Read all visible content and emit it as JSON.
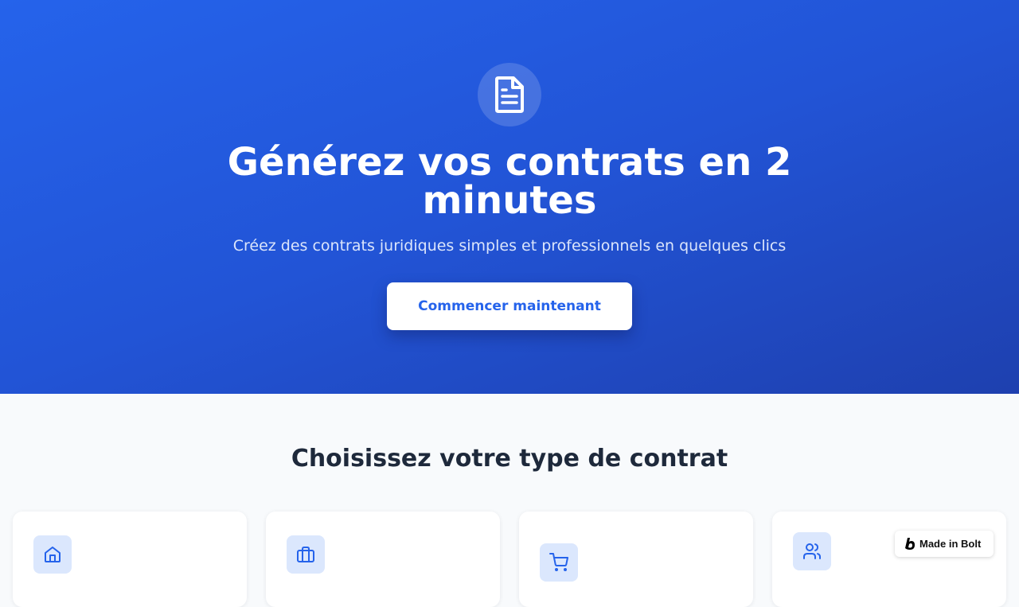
{
  "hero": {
    "icon": "document-text-icon",
    "title": "Générez vos contrats en 2 minutes",
    "subtitle": "Créez des contrats juridiques simples et professionnels en quelques clics",
    "cta_label": "Commencer maintenant"
  },
  "contract_section": {
    "title": "Choisissez votre type de contrat",
    "cards": [
      {
        "icon": "home-icon"
      },
      {
        "icon": "briefcase-icon"
      },
      {
        "icon": "shopping-cart-icon"
      },
      {
        "icon": "users-icon"
      }
    ]
  },
  "badge": {
    "label": "Made in Bolt",
    "icon": "bolt-logo-icon"
  },
  "colors": {
    "primary": "#2563eb",
    "hero_gradient_end": "#1e40af",
    "background": "#f8fafc",
    "heading": "#1e293b",
    "icon_tile": "#dbe7fd"
  }
}
